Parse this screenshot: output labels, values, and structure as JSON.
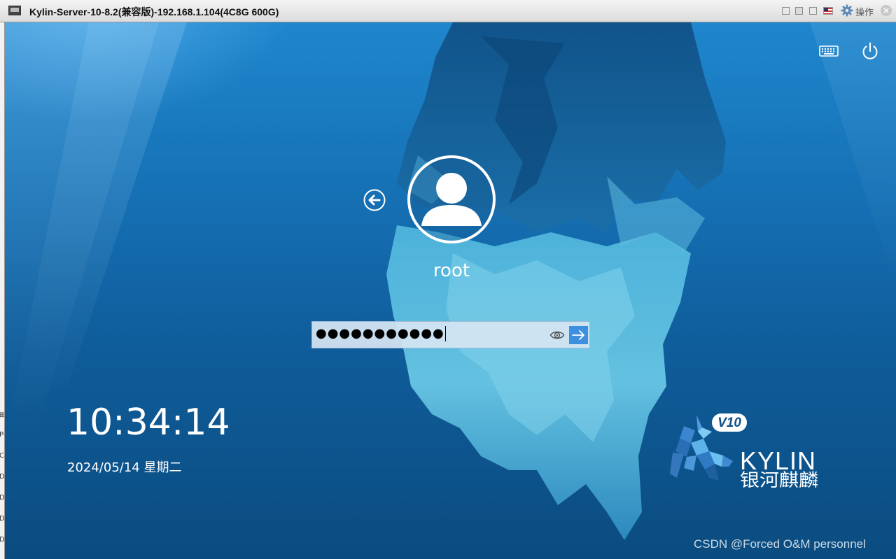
{
  "window": {
    "title": "Kylin-Server-10-8.2(兼容版)-192.168.1.104(4C8G 600G)",
    "action_label": "操作",
    "icons": [
      "vm-console-icon",
      "restore-icon",
      "minimize-icon",
      "maximize-icon",
      "us-flag-icon",
      "gear-icon",
      "close-icon"
    ]
  },
  "login": {
    "username": "root",
    "password_mask": "●●●●●●●●●●●",
    "icons": [
      "keyboard-icon",
      "power-icon",
      "back-arrow-icon",
      "user-avatar-icon",
      "eye-icon",
      "arrow-right-icon"
    ]
  },
  "clock": {
    "time": "10:34:14",
    "date": "2024/05/14 星期二"
  },
  "branding": {
    "version_badge": "V10",
    "product_name": "KYLIN",
    "product_name_cn": "银河麒麟"
  },
  "watermark": "CSDN @Forced O&M personnel",
  "colors": {
    "background_top": "#1f86cd",
    "background_bottom": "#0b4c80",
    "password_field": "#d5e5f3",
    "submit_button": "#3f8fe0"
  }
}
